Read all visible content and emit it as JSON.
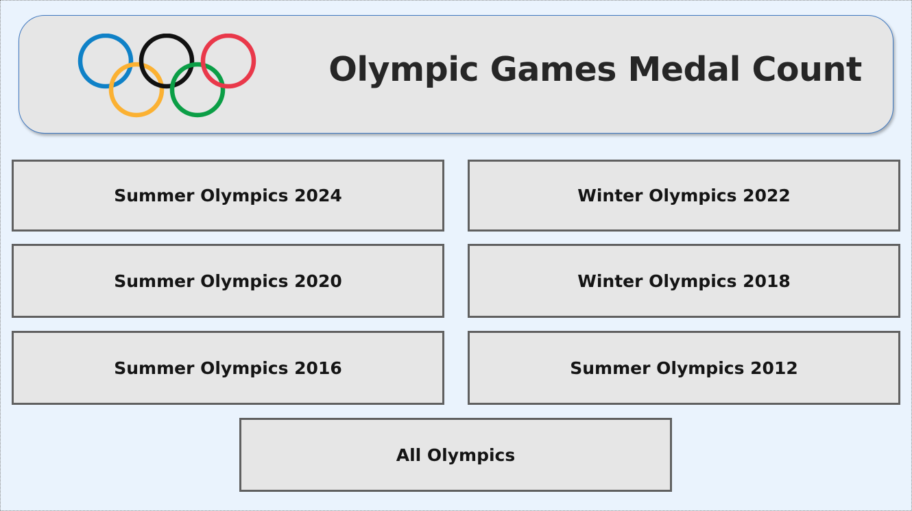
{
  "header": {
    "title": "Olympic Games Medal Count",
    "logo": {
      "icon": "olympic-rings-icon",
      "ring_colors": [
        "#0f81c7",
        "#111111",
        "#e9384a",
        "#fbb132",
        "#0b9e46"
      ]
    }
  },
  "buttons": {
    "summer_2024": "Summer Olympics 2024",
    "winter_2022": "Winter Olympics 2022",
    "summer_2020": "Summer Olympics 2020",
    "winter_2018": "Winter Olympics 2018",
    "summer_2016": "Summer Olympics 2016",
    "summer_2012": "Summer Olympics 2012",
    "all": "All Olympics"
  },
  "colors": {
    "background": "#eaf3fd",
    "panel": "#e6e6e6",
    "header_border": "#3f78c0",
    "button_border": "#606060",
    "text": "#262626"
  }
}
